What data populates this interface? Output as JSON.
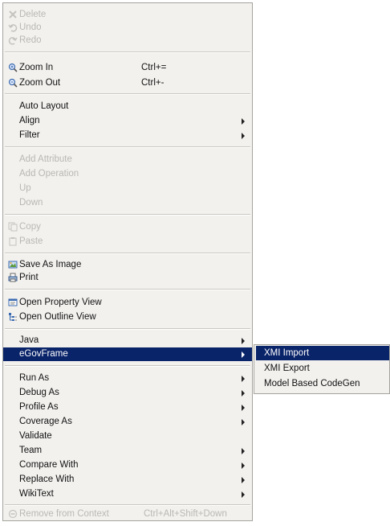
{
  "context_menu": {
    "items": [
      {
        "label": "Delete",
        "icon": "delete-icon",
        "disabled": true
      },
      {
        "label": "Undo",
        "icon": "undo-icon",
        "disabled": true
      },
      {
        "label": "Redo",
        "icon": "redo-icon",
        "disabled": true
      },
      {
        "label": "Zoom In",
        "icon": "zoom-in-icon",
        "shortcut": "Ctrl+="
      },
      {
        "label": "Zoom Out",
        "icon": "zoom-out-icon",
        "shortcut": "Ctrl+-"
      },
      {
        "label": "Auto Layout"
      },
      {
        "label": "Align",
        "submenu": true
      },
      {
        "label": "Filter",
        "submenu": true
      },
      {
        "label": "Add Attribute",
        "disabled": true
      },
      {
        "label": "Add Operation",
        "disabled": true
      },
      {
        "label": "Up",
        "disabled": true
      },
      {
        "label": "Down",
        "disabled": true
      },
      {
        "label": "Copy",
        "icon": "copy-icon",
        "disabled": true
      },
      {
        "label": "Paste",
        "icon": "paste-icon",
        "disabled": true
      },
      {
        "label": "Save As Image",
        "icon": "save-image-icon"
      },
      {
        "label": "Print",
        "icon": "print-icon"
      },
      {
        "label": "Open Property View",
        "icon": "property-view-icon"
      },
      {
        "label": "Open Outline View",
        "icon": "outline-view-icon"
      },
      {
        "label": "Java",
        "submenu": true
      },
      {
        "label": "eGovFrame",
        "submenu": true,
        "highlighted": true
      },
      {
        "label": "Run As",
        "submenu": true
      },
      {
        "label": "Debug As",
        "submenu": true
      },
      {
        "label": "Profile As",
        "submenu": true
      },
      {
        "label": "Coverage As",
        "submenu": true
      },
      {
        "label": "Validate"
      },
      {
        "label": "Team",
        "submenu": true
      },
      {
        "label": "Compare With",
        "submenu": true
      },
      {
        "label": "Replace With",
        "submenu": true
      },
      {
        "label": "WikiText",
        "submenu": true
      },
      {
        "label": "Remove from Context",
        "icon": "remove-context-icon",
        "shortcut": "Ctrl+Alt+Shift+Down",
        "disabled": true
      }
    ]
  },
  "submenu": {
    "items": [
      {
        "label": "XMI Import",
        "highlighted": true
      },
      {
        "label": "XMI Export"
      },
      {
        "label": "Model Based CodeGen"
      }
    ]
  },
  "colors": {
    "menu_bg": "#f2f1ee",
    "highlight_bg": "#0a246a",
    "highlight_fg": "#ffffff",
    "disabled_fg": "#b9b8b3"
  }
}
